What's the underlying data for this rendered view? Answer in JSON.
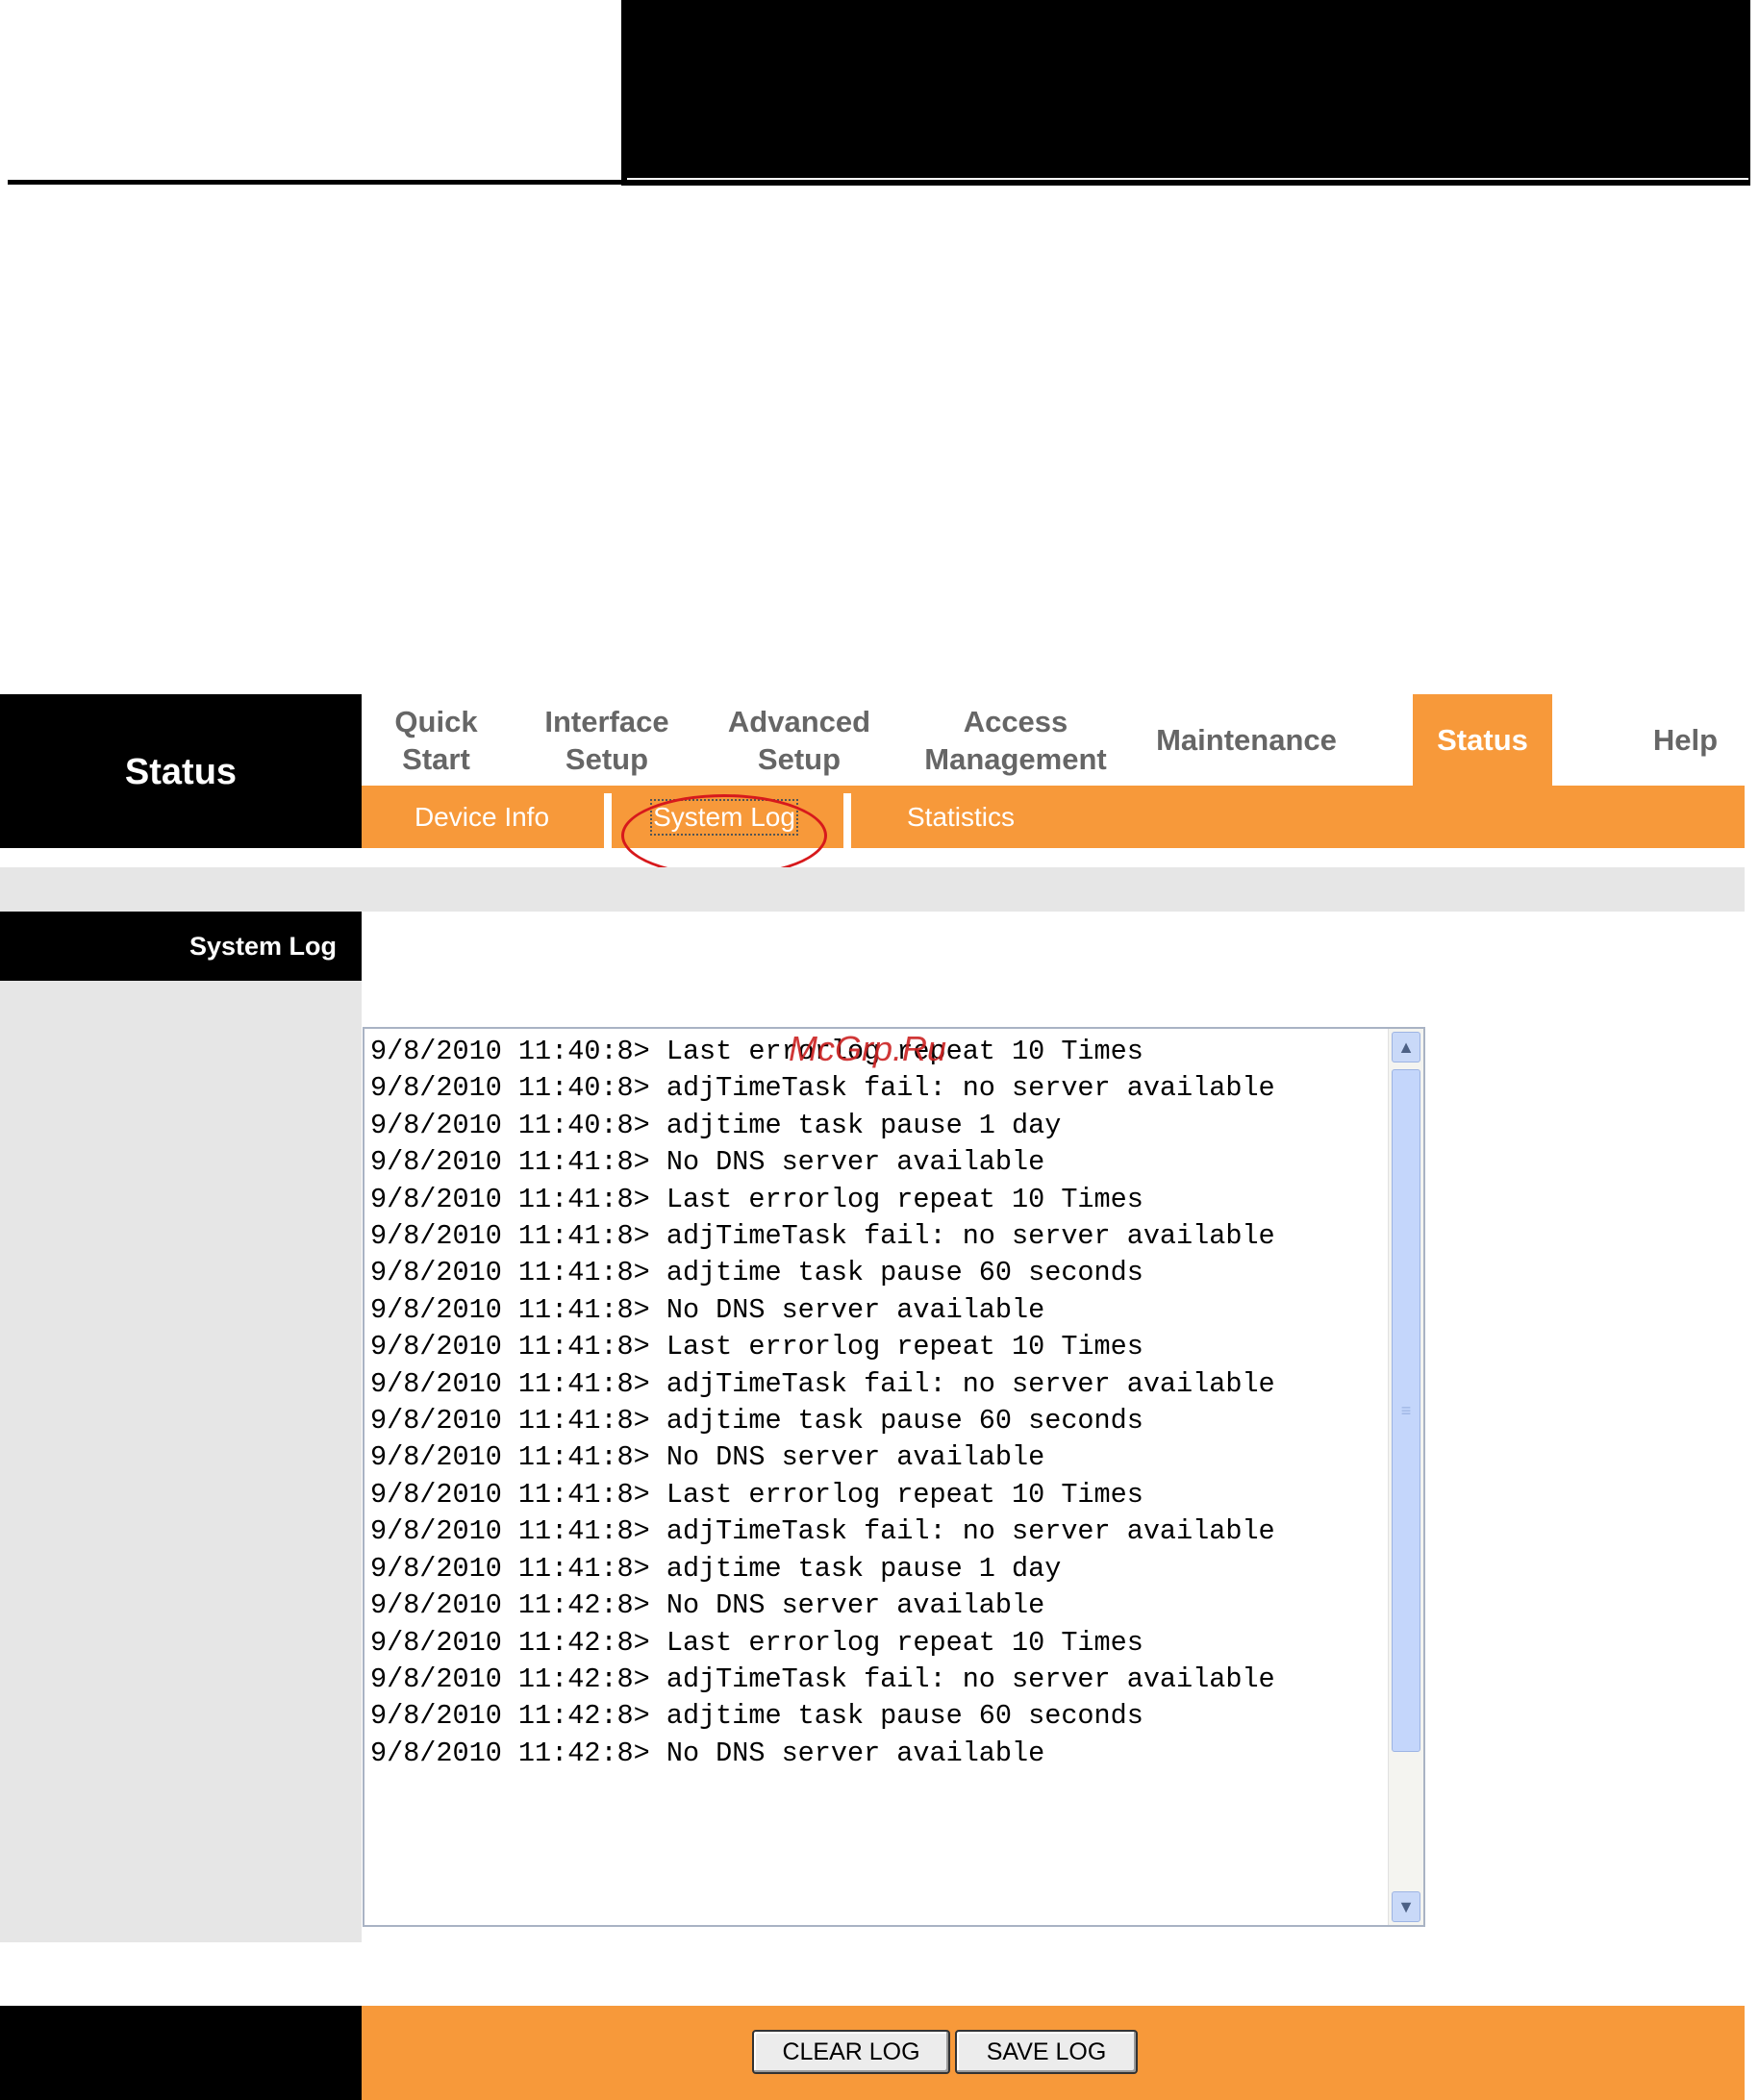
{
  "brand": {
    "title": "Status"
  },
  "nav": {
    "items": [
      {
        "label": "Quick\nStart"
      },
      {
        "label": "Interface\nSetup"
      },
      {
        "label": "Advanced\nSetup"
      },
      {
        "label": "Access\nManagement"
      },
      {
        "label": "Maintenance"
      },
      {
        "label": "Status",
        "active": true
      },
      {
        "label": "Help"
      }
    ]
  },
  "subnav": {
    "items": [
      {
        "label": "Device Info"
      },
      {
        "label": "System Log",
        "current": true
      },
      {
        "label": "Statistics"
      }
    ]
  },
  "section": {
    "title": "System Log"
  },
  "log": {
    "lines": [
      "9/8/2010 11:40:8> Last errorlog repeat 10 Times",
      "9/8/2010 11:40:8> adjTimeTask fail: no server available",
      "9/8/2010 11:40:8> adjtime task pause 1 day",
      "9/8/2010 11:41:8> No DNS server available",
      "9/8/2010 11:41:8> Last errorlog repeat 10 Times",
      "9/8/2010 11:41:8> adjTimeTask fail: no server available",
      "9/8/2010 11:41:8> adjtime task pause 60 seconds",
      "9/8/2010 11:41:8> No DNS server available",
      "9/8/2010 11:41:8> Last errorlog repeat 10 Times",
      "9/8/2010 11:41:8> adjTimeTask fail: no server available",
      "9/8/2010 11:41:8> adjtime task pause 60 seconds",
      "9/8/2010 11:41:8> No DNS server available",
      "9/8/2010 11:41:8> Last errorlog repeat 10 Times",
      "9/8/2010 11:41:8> adjTimeTask fail: no server available",
      "9/8/2010 11:41:8> adjtime task pause 1 day",
      "9/8/2010 11:42:8> No DNS server available",
      "9/8/2010 11:42:8> Last errorlog repeat 10 Times",
      "9/8/2010 11:42:8> adjTimeTask fail: no server available",
      "9/8/2010 11:42:8> adjtime task pause 60 seconds",
      "9/8/2010 11:42:8> No DNS server available"
    ]
  },
  "watermark": "McGrp.Ru",
  "buttons": {
    "clear": "CLEAR LOG",
    "save": "SAVE LOG"
  },
  "colors": {
    "accent": "#f7993a",
    "dark": "#000000",
    "panel": "#e6e6e6",
    "annotation": "#d7191c"
  },
  "icons": {
    "scroll_up": "chevron-up-icon",
    "scroll_down": "chevron-down-icon",
    "grip": "scroll-grip-icon"
  }
}
